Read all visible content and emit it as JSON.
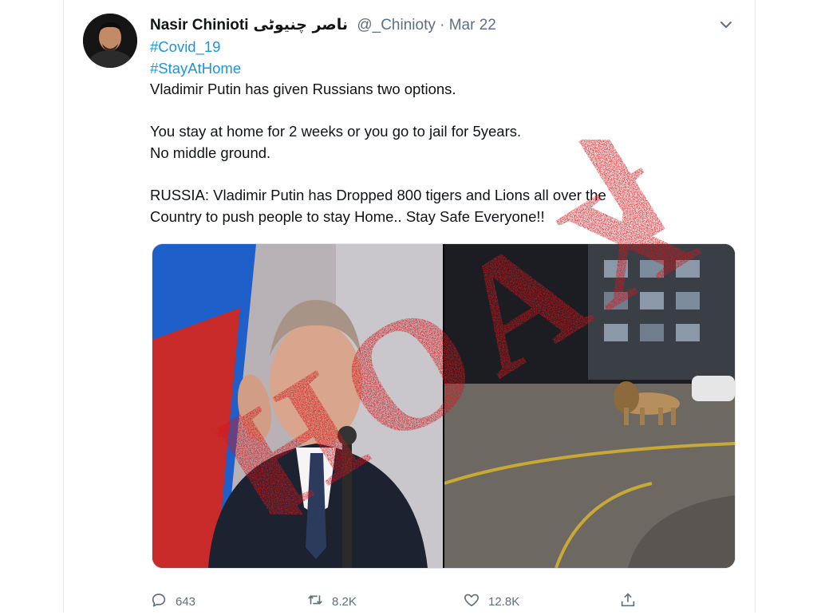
{
  "tweet": {
    "author": {
      "display_name": "Nasir Chinioti",
      "display_name_urdu": "ناصر چنیوٹی",
      "handle": "@_Chinioty",
      "separator": "·",
      "date": "Mar 22"
    },
    "hashtags": [
      "#Covid_19",
      "#StayAtHome"
    ],
    "lines": {
      "l1": "Vladimir Putin has given Russians two options.",
      "l2": "You stay at home for 2 weeks or you go to jail for 5years.",
      "l3": "No middle ground.",
      "l4": "RUSSIA: Vladimir Putin has Dropped 800 tigers and Lions all over the",
      "l5": "Country to push people to stay Home.. Stay Safe Everyone!!"
    },
    "stamp_text": "HOAX",
    "actions": {
      "replies": "643",
      "retweets": "8.2K",
      "likes": "12.8K"
    },
    "icons": {
      "more": "chevron-down-icon",
      "reply": "reply-icon",
      "retweet": "retweet-icon",
      "like": "heart-icon",
      "share": "share-icon"
    },
    "colors": {
      "link": "#1b95e0",
      "muted": "#5b7083",
      "stamp": "#d0161b"
    }
  }
}
